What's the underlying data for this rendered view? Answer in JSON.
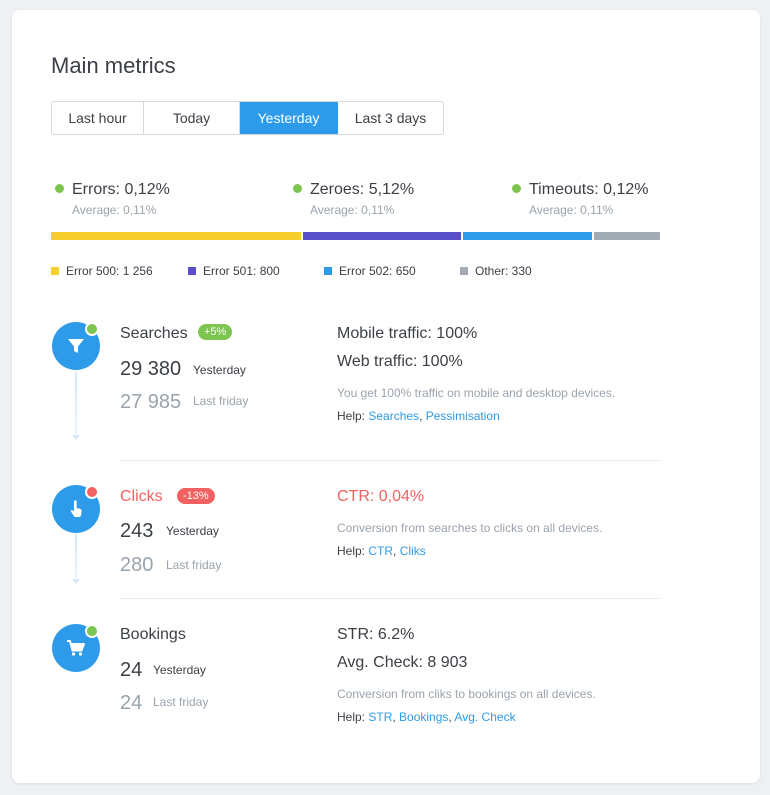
{
  "title": "Main metrics",
  "tabs": [
    {
      "label": "Last hour",
      "active": false
    },
    {
      "label": "Today",
      "active": false
    },
    {
      "label": "Yesterday",
      "active": true
    },
    {
      "label": "Last 3 days",
      "active": false
    }
  ],
  "kpis": [
    {
      "label": "Errors: 0,12%",
      "average": "Average: 0,11%",
      "status_color": "#7dc451"
    },
    {
      "label": "Zeroes: 5,12%",
      "average": "Average: 0,11%",
      "status_color": "#7dc451"
    },
    {
      "label": "Timeouts: 0,12%",
      "average": "Average: 0,11%",
      "status_color": "#7dc451"
    }
  ],
  "error_bar": [
    {
      "label": "Error 500: 1 256",
      "value": 1256,
      "color": "#f7cf2d"
    },
    {
      "label": "Error 501: 800",
      "value": 800,
      "color": "#5a4fcb"
    },
    {
      "label": "Error 502: 650",
      "value": 650,
      "color": "#2e9bea"
    },
    {
      "label": "Other: 330",
      "value": 330,
      "color": "#a3acb5"
    }
  ],
  "sections": {
    "searches": {
      "title": "Searches",
      "badge": "+5%",
      "badge_color": "#7dc451",
      "status_color": "#7dc451",
      "current_value": "29 380",
      "current_label": "Yesterday",
      "previous_value": "27 985",
      "previous_label": "Last friday",
      "metrics": [
        "Mobile traffic: 100%",
        "Web traffic: 100%"
      ],
      "description": "You get 100% traffic on mobile and desktop devices.",
      "help_label": "Help:",
      "help_links": [
        "Searches",
        "Pessimisation"
      ]
    },
    "clicks": {
      "title": "Clicks",
      "badge": "-13%",
      "badge_color": "#f26161",
      "status_color": "#f26161",
      "current_value": "243",
      "current_label": "Yesterday",
      "previous_value": "280",
      "previous_label": "Last friday",
      "metrics": [
        "CTR: 0,04%"
      ],
      "description": "Conversion from searches  to clicks on all devices.",
      "help_label": "Help:",
      "help_links": [
        "CTR",
        "Cliks"
      ]
    },
    "bookings": {
      "title": "Bookings",
      "status_color": "#7dc451",
      "current_value": "24",
      "current_label": "Yesterday",
      "previous_value": "24",
      "previous_label": "Last friday",
      "metrics": [
        "STR: 6.2%",
        "Avg. Check: 8 903"
      ],
      "description": "Conversion from cliks  to bookings on all devices.",
      "help_label": "Help:",
      "help_links": [
        "STR",
        "Bookings",
        "Avg. Check"
      ]
    }
  },
  "icons": {
    "searches": "filter-icon",
    "clicks": "hand-pointer-icon",
    "bookings": "cart-icon"
  }
}
